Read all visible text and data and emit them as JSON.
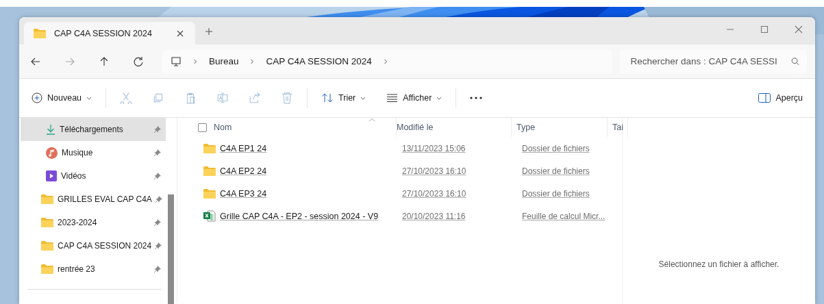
{
  "tabs": [
    {
      "label": "CAP C4A SESSION 2024",
      "selected": true
    }
  ],
  "breadcrumb": [
    "Bureau",
    "CAP C4A SESSION 2024"
  ],
  "search": {
    "placeholder": "Rechercher dans : CAP C4A SESSI"
  },
  "toolbar": {
    "new": "Nouveau",
    "actions": [
      {
        "kind": "cut",
        "disabled": true
      },
      {
        "kind": "copy",
        "disabled": true
      },
      {
        "kind": "paste",
        "disabled": true
      },
      {
        "kind": "rename",
        "disabled": true
      },
      {
        "kind": "share",
        "disabled": true
      },
      {
        "kind": "delete",
        "disabled": true
      }
    ],
    "sort": "Trier",
    "view": "Afficher",
    "preview": "Aperçu"
  },
  "sidebar": {
    "items": [
      {
        "label": "Téléchargements",
        "kind": "downloads",
        "selected": true,
        "pinned": true
      },
      {
        "label": "Musique",
        "kind": "music",
        "selected": false,
        "pinned": true
      },
      {
        "label": "Vidéos",
        "kind": "videos",
        "selected": false,
        "pinned": true
      },
      {
        "label": "GRILLES EVAL CAP C4A",
        "kind": "folder",
        "selected": false,
        "pinned": true
      },
      {
        "label": "2023-2024",
        "kind": "folder",
        "selected": false,
        "pinned": true
      },
      {
        "label": "CAP C4A SESSION 2024",
        "kind": "folder",
        "selected": false,
        "pinned": true
      },
      {
        "label": "rentrée 23",
        "kind": "folder",
        "selected": false,
        "pinned": true
      }
    ]
  },
  "table": {
    "select_all": {
      "checked": false
    },
    "columns": [
      "Nom",
      "Modifié le",
      "Type",
      "Tai"
    ],
    "rows": [
      {
        "name": "C4A EP1 24",
        "modified": "13/11/2023 15:06",
        "type": "Dossier de fichiers",
        "kind": "folder"
      },
      {
        "name": "C4A EP2 24",
        "modified": "27/10/2023 16:10",
        "type": "Dossier de fichiers",
        "kind": "folder"
      },
      {
        "name": "C4A EP3 24",
        "modified": "27/10/2023 16:10",
        "type": "Dossier de fichiers",
        "kind": "folder"
      },
      {
        "name": "Grille CAP C4A - EP2 - session 2024 - V9",
        "modified": "20/10/2023 11:16",
        "type": "Feuille de calcul Micr...",
        "kind": "spreadsheet"
      }
    ]
  },
  "preview_pane": {
    "message": "Sélectionnez un fichier à afficher."
  }
}
